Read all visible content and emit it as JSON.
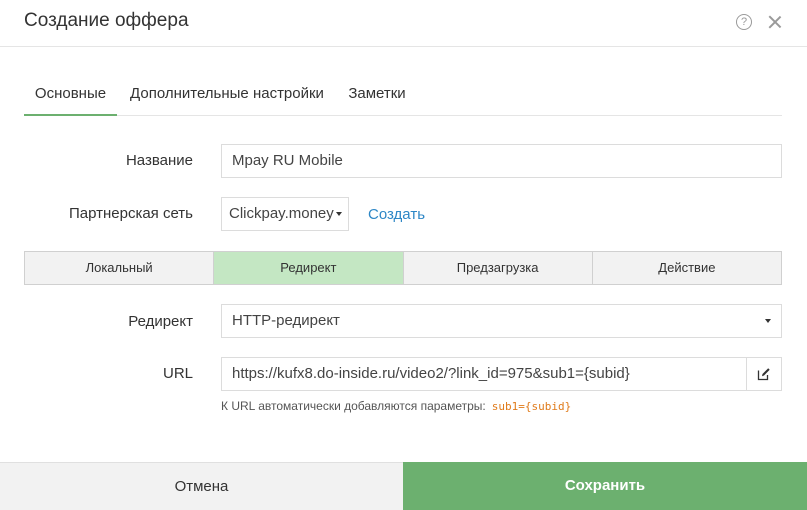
{
  "header": {
    "title": "Создание оффера",
    "help_icon": "?"
  },
  "tabs": [
    {
      "label": "Основные",
      "active": true
    },
    {
      "label": "Дополнительные настройки",
      "active": false
    },
    {
      "label": "Заметки",
      "active": false
    }
  ],
  "form": {
    "name_label": "Название",
    "name_value": "Mpay RU Mobile",
    "network_label": "Партнерская сеть",
    "network_value": "Clickpay.money",
    "create_link": "Создать",
    "type_segments": [
      "Локальный",
      "Редирект",
      "Предзагрузка",
      "Действие"
    ],
    "type_selected": "Редирект",
    "redirect_label": "Редирект",
    "redirect_value": "HTTP-редирект",
    "url_label": "URL",
    "url_value": "https://kufx8.do-inside.ru/video2/?link_id=975&sub1={subid}",
    "hint_text": "К URL автоматически добавляются параметры:",
    "hint_code": "sub1={subid}"
  },
  "footer": {
    "cancel_label": "Отмена",
    "save_label": "Сохранить"
  },
  "colors": {
    "accent_green": "#6cb06f",
    "segment_active": "#c4e7c3",
    "link_blue": "#2e87c6",
    "code_orange": "#e07b1b"
  }
}
